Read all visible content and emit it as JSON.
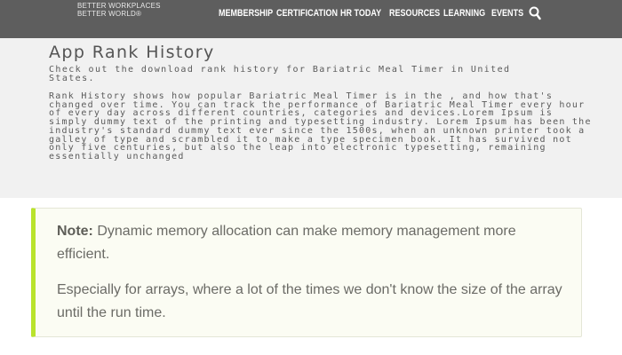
{
  "header": {
    "brand_line1": "BETTER WORKPLACES",
    "brand_line2": "BETTER WORLD",
    "nav": [
      "MEMBERSHIP",
      "CERTIFICATION",
      "HR TODAY",
      "RESOURCES",
      "LEARNING",
      "EVENTS"
    ],
    "search_icon": "search-icon",
    "bg_color": "#5e5e5e"
  },
  "main": {
    "title": "App Rank History",
    "intro": "Check out the download rank history for Bariatric Meal Timer in United States.",
    "body": "Rank History shows how popular Bariatric Meal Timer is in the , and how that's changed over time. You can track the performance of Bariatric Meal Timer every hour of every day across different countries, categories and devices.Lorem Ipsum is simply dummy text of the printing and typesetting industry. Lorem Ipsum has been the industry's standard dummy text ever since the 1500s, when an unknown printer took a galley of type and scrambled it to make a type specimen book. It has survived not only five centuries, but also the leap into electronic typesetting, remaining essentially unchanged"
  },
  "note": {
    "label": "Note:",
    "text1": "Dynamic memory allocation can make memory management more efficient.",
    "text2": "Especially for arrays, where a lot of the times we don't know the size of the array until the run time.",
    "accent_color": "#b9e32c"
  }
}
